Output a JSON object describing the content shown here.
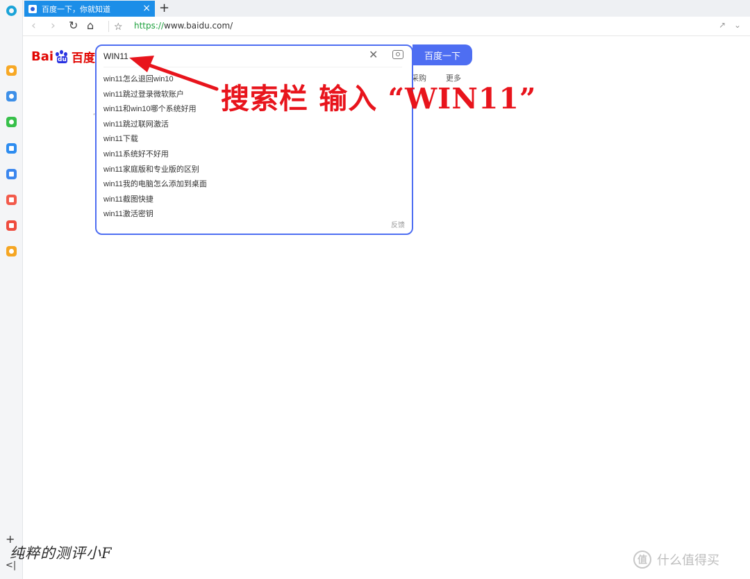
{
  "tab": {
    "title": "百度一下，你就知道",
    "close": "×",
    "new_tab": "+"
  },
  "toolbar": {
    "url_scheme": "https://",
    "url_rest": "www.baidu.com/",
    "back": "‹",
    "forward": "›",
    "reload": "↻",
    "home": "⌂",
    "star": "☆",
    "share": "↗",
    "menu": "⌄"
  },
  "logo": {
    "latin": "Bai",
    "du": "du",
    "cn": "百度"
  },
  "search": {
    "query": "WIN11",
    "clear": "✕",
    "button": "百度一下",
    "feedback": "反馈",
    "suggestions": [
      "win11怎么退回win10",
      "win11跳过登录微软账户",
      "win11和win10哪个系统好用",
      "win11跳过联网激活",
      "win11下载",
      "win11系统好不好用",
      "win11家庭版和专业版的区别",
      "win11我的电脑怎么添加到桌面",
      "win11截图快捷",
      "win11激活密钥"
    ]
  },
  "nav_peek": [
    "采购",
    "更多"
  ],
  "annotation": {
    "text": "搜索栏 输入 “WIN11”",
    "color": "#e8141c"
  },
  "watermark": {
    "left": "纯粹的测评小F",
    "right": "什么值得买",
    "logo_char": "值"
  },
  "sidebar_bottom": {
    "add": "+",
    "collapse": "<|"
  },
  "colors": {
    "accent": "#4e6ef2",
    "tab_active": "#1c8ee8",
    "baidu_red": "#e10602",
    "baidu_blue": "#2932e1"
  },
  "icons": {
    "rail": [
      "star-icon",
      "clock-icon",
      "wechat-icon",
      "cloud-upload-icon",
      "mountain-icon",
      "screenshot-icon",
      "pdf-icon",
      "search-icon"
    ]
  }
}
